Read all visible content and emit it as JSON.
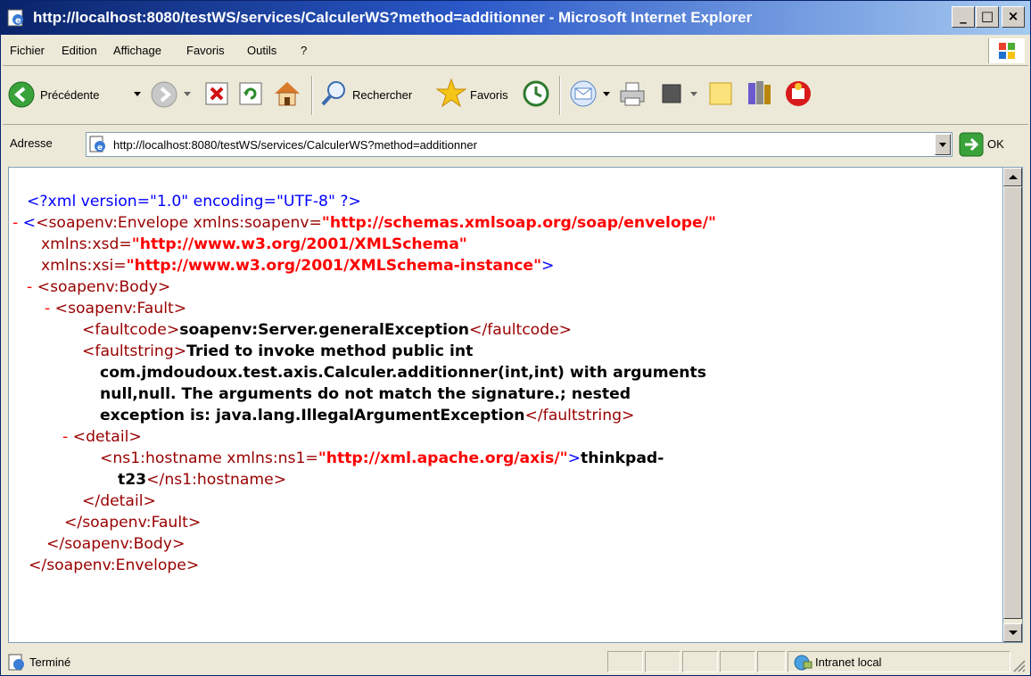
{
  "window": {
    "title": "http://localhost:8080/testWS/services/CalculerWS?method=additionner - Microsoft Internet Explorer",
    "minimize_glyph": "_",
    "maximize_glyph": "□",
    "close_glyph": "×"
  },
  "menubar": {
    "items": [
      "Fichier",
      "Edition",
      "Affichage",
      "Favoris",
      "Outils",
      "?"
    ]
  },
  "toolbar": {
    "back_label": "Précédente",
    "search_label": "Rechercher",
    "favorites_label": "Favoris"
  },
  "address": {
    "label": "Adresse",
    "url": "http://localhost:8080/testWS/services/CalculerWS?method=additionner",
    "go_label": "OK"
  },
  "xml": {
    "decl": "<?xml version=\"1.0\" encoding=\"UTF-8\" ?>",
    "minus": "-",
    "envelope_open": "<soapenv:Envelope",
    "xmlns_soapenv_attr": "xmlns:soapenv=",
    "xmlns_soapenv_val": "\"http://schemas.xmlsoap.org/soap/envelope/\"",
    "xmlns_xsd_attr": "xmlns:xsd=",
    "xmlns_xsd_val": "\"http://www.w3.org/2001/XMLSchema\"",
    "xmlns_xsi_attr": "xmlns:xsi=",
    "xmlns_xsi_val": "\"http://www.w3.org/2001/XMLSchema-instance\"",
    "gt": ">",
    "body_open": "<soapenv:Body>",
    "fault_open": "<soapenv:Fault>",
    "faultcode_open": "<faultcode>",
    "faultcode_text": "soapenv:Server.generalException",
    "faultcode_close": "</faultcode>",
    "faultstring_open": "<faultstring>",
    "faultstring_line1": "Tried to invoke method public int",
    "faultstring_line2": "com.jmdoudoux.test.axis.Calculer.additionner(int,int) with arguments",
    "faultstring_line3": "null,null. The arguments do not match the signature.; nested",
    "faultstring_line4": "exception is: java.lang.IllegalArgumentException",
    "faultstring_close": "</faultstring>",
    "detail_open": "<detail>",
    "hostname_open": "<ns1:hostname",
    "xmlns_ns1_attr": "xmlns:ns1=",
    "xmlns_ns1_val": "\"http://xml.apache.org/axis/\"",
    "hostname_text1": "thinkpad-",
    "hostname_text2": "t23",
    "hostname_close": "</ns1:hostname>",
    "detail_close": "</detail>",
    "fault_close": "</soapenv:Fault>",
    "body_close": "</soapenv:Body>",
    "envelope_close": "</soapenv:Envelope>"
  },
  "status": {
    "text": "Terminé",
    "zone": "Intranet local"
  },
  "colors": {
    "titlebar": "#0a246a",
    "markup_blue": "#0000ff",
    "element_name": "#990000",
    "attr_value": "#ff0000"
  }
}
